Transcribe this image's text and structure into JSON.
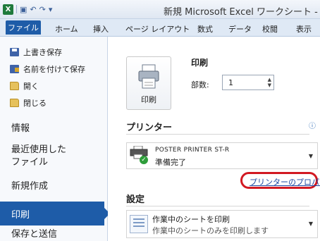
{
  "title": "新規 Microsoft Excel ワークシート -",
  "quick_access": {
    "app_icon": "X",
    "save_icon": "save-icon",
    "undo_icon": "undo-icon",
    "redo_icon": "redo-icon"
  },
  "ribbon_tabs": [
    "ファイル",
    "ホーム",
    "挿入",
    "ページ レイアウト",
    "数式",
    "データ",
    "校閲",
    "表示"
  ],
  "nav": {
    "commands": [
      "上書き保存",
      "名前を付けて保存",
      "開く",
      "閉じる"
    ],
    "sections": [
      "情報",
      "最近使用した\nファイル",
      "新規作成",
      "印刷",
      "保存と送信"
    ],
    "active": "印刷"
  },
  "print": {
    "button_label": "印刷",
    "heading": "印刷",
    "copies_label": "部数:",
    "copies_value": "1"
  },
  "printer": {
    "section_title": "プリンター",
    "name": "POSTER PRINTER ST-R",
    "status": "準備完了",
    "properties_link": "プリンターのプロパティ"
  },
  "settings": {
    "section_title": "設定",
    "option_main": "作業中のシートを印刷",
    "option_sub": "作業中のシートのみを印刷します"
  },
  "colors": {
    "accent": "#1e5ca8",
    "highlight_ring": "#d21922",
    "ready_check": "#2e9d3a"
  }
}
